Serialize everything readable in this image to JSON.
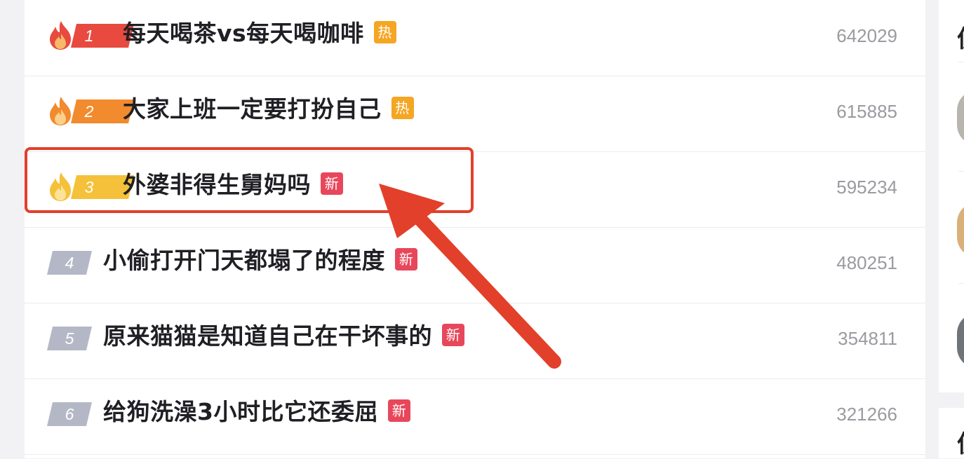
{
  "hot_search": {
    "items": [
      {
        "rank": "1",
        "title": "每天喝茶vs每天喝咖啡",
        "tag": "热",
        "tag_type": "hot",
        "count": "642029",
        "rank_color": "#e84a3f",
        "flame": true
      },
      {
        "rank": "2",
        "title": "大家上班一定要打扮自己",
        "tag": "热",
        "tag_type": "hot",
        "count": "615885",
        "rank_color": "#f28a2e",
        "flame": true
      },
      {
        "rank": "3",
        "title": "外婆非得生舅妈吗",
        "tag": "新",
        "tag_type": "new",
        "count": "595234",
        "rank_color": "#f5c13a",
        "flame": true
      },
      {
        "rank": "4",
        "title": "小偷打开门天都塌了的程度",
        "tag": "新",
        "tag_type": "new",
        "count": "480251",
        "rank_color": "#b4b8c6",
        "flame": false
      },
      {
        "rank": "5",
        "title": "原来猫猫是知道自己在干坏事的",
        "tag": "新",
        "tag_type": "new",
        "count": "354811",
        "rank_color": "#b4b8c6",
        "flame": false
      },
      {
        "rank": "6",
        "title": "给狗洗澡3小时比它还委屈",
        "tag": "新",
        "tag_type": "new",
        "count": "321266",
        "rank_color": "#b4b8c6",
        "flame": false
      }
    ]
  },
  "colors": {
    "annotation_red": "#e2402a",
    "hot_tag": "#f5a623",
    "new_tag": "#e8475b"
  },
  "sidebar": {
    "heading_glyph_top": "仿",
    "heading_glyph_bottom": "仿"
  }
}
